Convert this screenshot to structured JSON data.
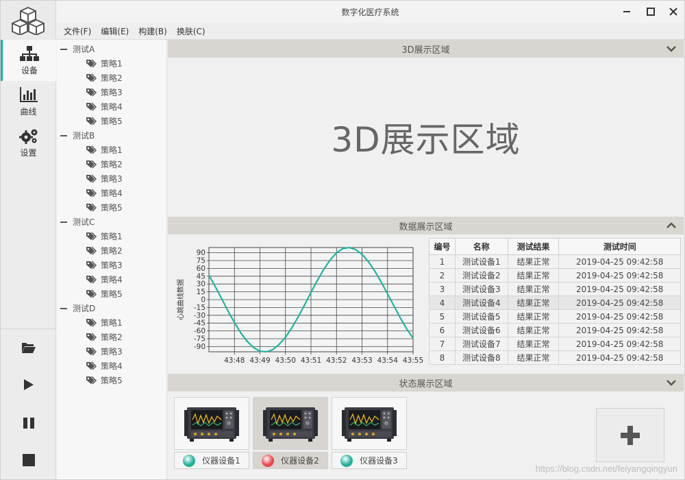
{
  "window": {
    "title": "数字化医疗系统"
  },
  "menu": [
    "文件(F)",
    "编辑(E)",
    "构建(B)",
    "换肤(C)"
  ],
  "nav": {
    "device": "设备",
    "curve": "曲线",
    "settings": "设置"
  },
  "tree": [
    {
      "name": "测试A",
      "items": [
        "策略1",
        "策略2",
        "策略3",
        "策略4",
        "策略5"
      ]
    },
    {
      "name": "测试B",
      "items": [
        "策略1",
        "策略2",
        "策略3",
        "策略4",
        "策略5"
      ]
    },
    {
      "name": "测试C",
      "items": [
        "策略1",
        "策略2",
        "策略3",
        "策略4",
        "策略5"
      ]
    },
    {
      "name": "测试D",
      "items": [
        "策略1",
        "策略2",
        "策略3",
        "策略4",
        "策略5"
      ]
    }
  ],
  "sections": {
    "s3d": {
      "header": "3D展示区域",
      "content": "3D展示区域"
    },
    "data": {
      "header": "数据展示区域"
    },
    "status": {
      "header": "状态展示区域"
    }
  },
  "chart_data": {
    "type": "line",
    "title": "",
    "xlabel": "",
    "ylabel": "心跳曲线数据",
    "ylim": [
      -100,
      100
    ],
    "yticks": [
      90,
      75,
      60,
      45,
      30,
      15,
      0,
      -15,
      -30,
      -45,
      -60,
      -75,
      -90
    ],
    "xticks": [
      "43:48",
      "43:49",
      "43:50",
      "43:51",
      "43:52",
      "43:53",
      "43:54",
      "43:55"
    ],
    "grid": true,
    "color": "#1bb5a0",
    "series": [
      {
        "x": [
          0,
          0.25,
          0.5,
          0.75,
          1.0,
          1.25,
          1.5,
          1.75,
          2.0,
          2.25,
          2.5,
          2.75,
          3.0,
          3.25,
          3.5,
          3.75,
          4.0,
          4.25,
          4.5,
          4.75,
          5.0,
          5.25,
          5.5,
          5.75,
          6.0,
          6.25,
          6.5,
          6.75,
          7.0,
          7.25,
          7.5,
          7.75,
          8.0
        ],
        "y": [
          47,
          25,
          2,
          -22,
          -44,
          -64,
          -80,
          -92,
          -99,
          -100,
          -96,
          -86,
          -72,
          -54,
          -33,
          -10,
          14,
          37,
          58,
          76,
          90,
          98,
          100,
          96,
          87,
          73,
          55,
          34,
          11,
          -12,
          -35,
          -56,
          -74
        ]
      }
    ]
  },
  "table": {
    "columns": [
      "编号",
      "名称",
      "测试结果",
      "测试时间"
    ],
    "rows": [
      [
        "1",
        "测试设备1",
        "结果正常",
        "2019-04-25 09:42:58"
      ],
      [
        "2",
        "测试设备2",
        "结果正常",
        "2019-04-25 09:42:58"
      ],
      [
        "3",
        "测试设备3",
        "结果正常",
        "2019-04-25 09:42:58"
      ],
      [
        "4",
        "测试设备4",
        "结果正常",
        "2019-04-25 09:42:58"
      ],
      [
        "5",
        "测试设备5",
        "结果正常",
        "2019-04-25 09:42:58"
      ],
      [
        "6",
        "测试设备6",
        "结果正常",
        "2019-04-25 09:42:58"
      ],
      [
        "7",
        "测试设备7",
        "结果正常",
        "2019-04-25 09:42:58"
      ],
      [
        "8",
        "测试设备8",
        "结果正常",
        "2019-04-25 09:42:58"
      ]
    ]
  },
  "devices": [
    {
      "label": "仪器设备1",
      "status_color": "#1fb09a"
    },
    {
      "label": "仪器设备2",
      "status_color": "#e8474b"
    },
    {
      "label": "仪器设备3",
      "status_color": "#1fb09a"
    }
  ],
  "watermark": "https://blog.csdn.net/feiyangqingyun",
  "colors": {
    "accent": "#16b39a",
    "header_bg": "#d9d6d1"
  }
}
